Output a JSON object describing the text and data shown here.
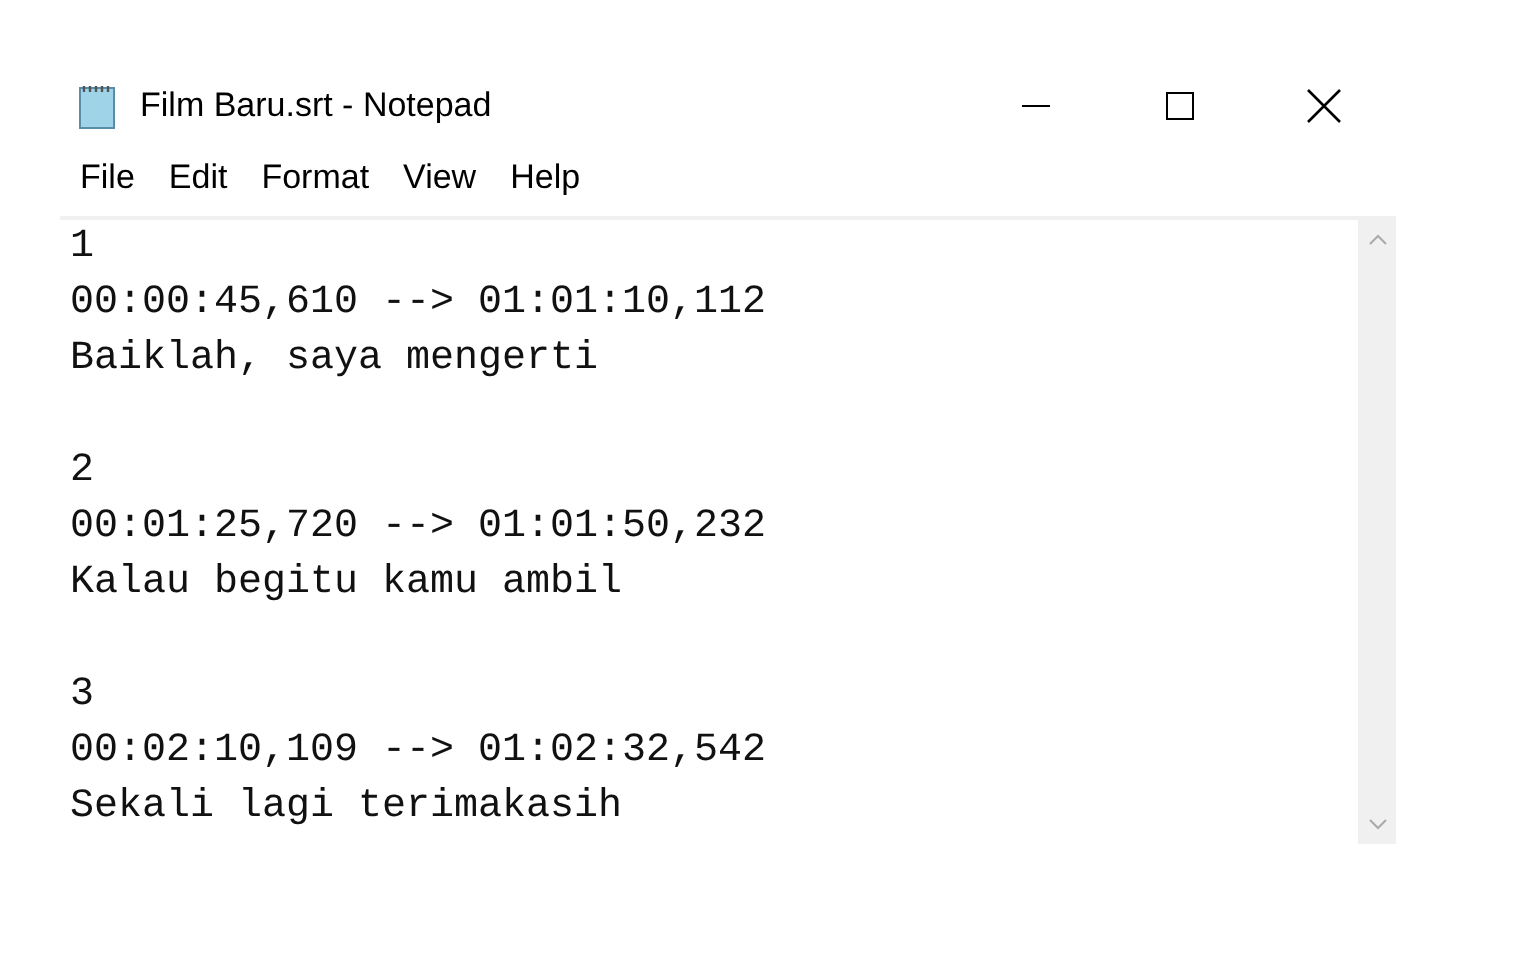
{
  "window": {
    "title": "Film Baru.srt - Notepad"
  },
  "menu": [
    "File",
    "Edit",
    "Format",
    "View",
    "Help"
  ],
  "subtitles": [
    {
      "number": "1",
      "timing": "00:00:45,610 --> 01:01:10,112",
      "text": "Baiklah, saya mengerti"
    },
    {
      "number": "2",
      "timing": "00:01:25,720 --> 01:01:50,232",
      "text": "Kalau begitu kamu ambil"
    },
    {
      "number": "3",
      "timing": "00:02:10,109 --> 01:02:32,542",
      "text": "Sekali lagi terimakasih"
    }
  ]
}
